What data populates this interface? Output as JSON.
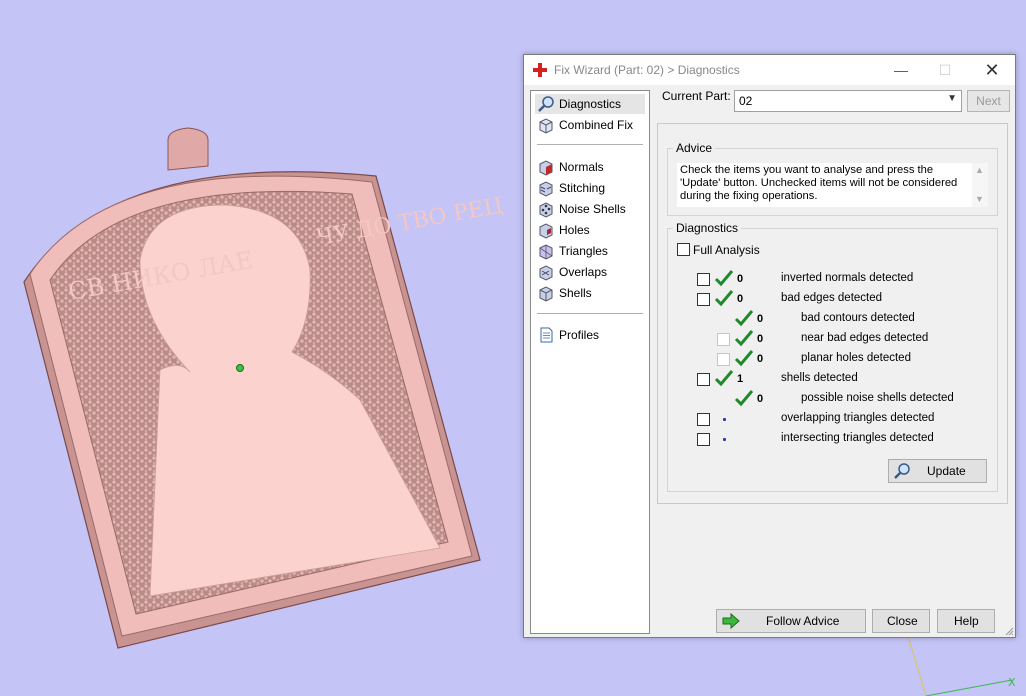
{
  "dialog": {
    "title": "Fix Wizard (Part: 02) > Diagnostics",
    "controls": {
      "minimize": "—",
      "maximize": "☐",
      "close": "✕"
    }
  },
  "nav": {
    "items": [
      {
        "label": "Diagnostics",
        "icon": "magnifier-icon",
        "selected": true
      },
      {
        "label": "Combined Fix",
        "icon": "cube-icon"
      },
      {
        "label": "Normals",
        "icon": "normals-cube-icon"
      },
      {
        "label": "Stitching",
        "icon": "stitching-cube-icon"
      },
      {
        "label": "Noise Shells",
        "icon": "noise-cube-icon"
      },
      {
        "label": "Holes",
        "icon": "holes-cube-icon"
      },
      {
        "label": "Triangles",
        "icon": "triangles-cube-icon"
      },
      {
        "label": "Overlaps",
        "icon": "overlaps-cube-icon"
      },
      {
        "label": "Shells",
        "icon": "shells-cube-icon"
      },
      {
        "label": "Profiles",
        "icon": "document-icon"
      }
    ]
  },
  "current_part": {
    "label": "Current Part:",
    "value": "02",
    "next_label": "Next"
  },
  "advice": {
    "legend": "Advice",
    "text": "Check the items you want to analyse and press the 'Update' button. Unchecked items will not be considered during the fixing operations."
  },
  "diagnostics": {
    "legend": "Diagnostics",
    "full_analysis": "Full Analysis",
    "rows": [
      {
        "value": "0",
        "label": "inverted normals detected",
        "status": "ok"
      },
      {
        "value": "0",
        "label": "bad edges detected",
        "status": "ok"
      },
      {
        "value": "0",
        "label": "bad contours detected",
        "status": "ok"
      },
      {
        "value": "0",
        "label": "near bad edges detected",
        "status": "ok"
      },
      {
        "value": "0",
        "label": "planar holes detected",
        "status": "ok"
      },
      {
        "value": "1",
        "label": "shells detected",
        "status": "ok"
      },
      {
        "value": "0",
        "label": "possible noise shells detected",
        "status": "ok"
      },
      {
        "value": "",
        "label": "overlapping triangles detected",
        "status": "not-analysed"
      },
      {
        "value": "",
        "label": "intersecting triangles detected",
        "status": "not-analysed"
      }
    ],
    "update_label": "Update"
  },
  "footer": {
    "follow_advice": "Follow Advice",
    "close": "Close",
    "help": "Help"
  },
  "viewport": {
    "background": "#c4c4f7",
    "model_color": "#f7cfcc",
    "left_text": "СВ НИКО ЛАЕ",
    "right_text": "ЧУ ДО ТВО РЕЦ"
  },
  "colors": {
    "accent_check": "#1f8a2a",
    "status_dot": "#2a3aa0"
  }
}
